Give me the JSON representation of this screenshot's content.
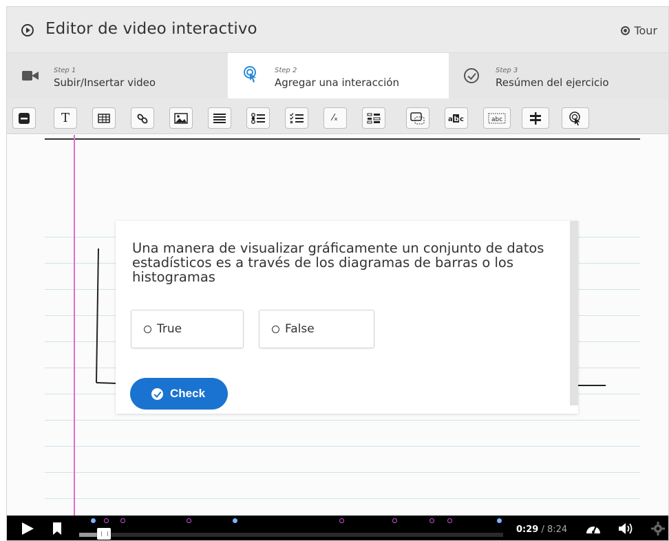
{
  "header": {
    "title": "Editor de video interactivo",
    "tour_label": "Tour"
  },
  "steps": [
    {
      "num": "Step 1",
      "label": "Subir/Insertar video",
      "icon": "video-camera-icon"
    },
    {
      "num": "Step 2",
      "label": "Agregar una interacción",
      "icon": "interaction-pointer-icon",
      "active": true
    },
    {
      "num": "Step 3",
      "label": "Resúmen del ejercicio",
      "icon": "check-circle-icon"
    }
  ],
  "toolbar": {
    "buttons": [
      "label-icon",
      "text-icon",
      "table-icon",
      "link-icon",
      "image-icon",
      "statements-icon",
      "single-choice-icon",
      "multiple-choice-icon",
      "true-false-icon",
      "drag-and-drop-icon",
      "crossroads-icon",
      "mark-the-words-icon",
      "drag-text-icon",
      "navigation-hotspot-icon",
      "goto-icon"
    ],
    "text_label": "T",
    "frac_label": "⁄ₓ",
    "abc_label": "abc"
  },
  "question": {
    "text": "Una manera de visualizar gráficamente un conjunto de datos estadísticos es a través de los diagramas de barras o los histogramas",
    "options": [
      "True",
      "False"
    ],
    "check_label": "Check"
  },
  "player": {
    "current_time": "0:29",
    "separator": " / ",
    "total_time": "8:24",
    "progress_fraction": 0.058
  },
  "colors": {
    "accent": "#1a73d0",
    "margin_line": "#e46ad2",
    "rule_line": "#cfe3ec",
    "marker_bullet": "#7bb3ff",
    "marker_ring": "#d34edb"
  }
}
